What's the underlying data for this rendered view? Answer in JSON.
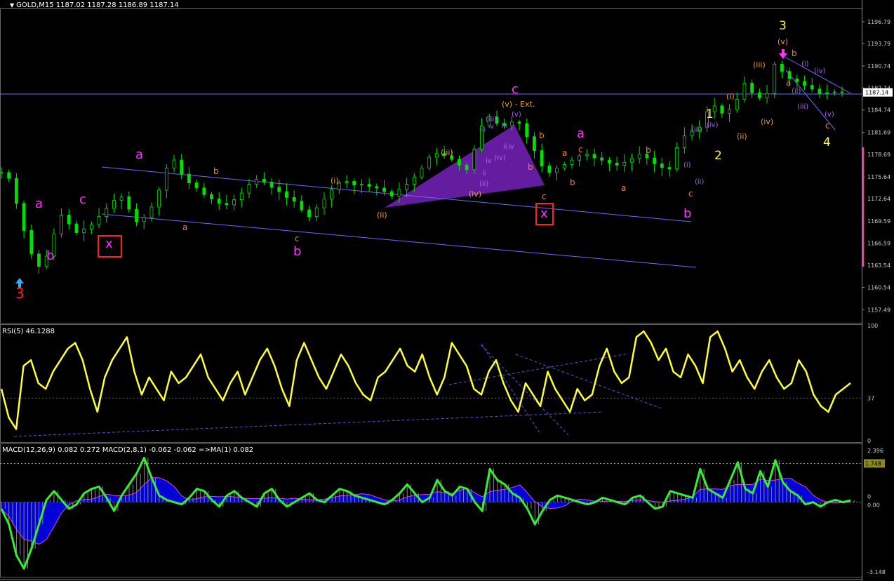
{
  "window": {
    "symbol_header": "GOLD,M15  1187.02 1187.28 1186.89 1187.14",
    "rsi_header": "RSI(5) 46.1288",
    "macd_header": "MACD(12,26,9) 0.082 0.272  MACD(2,8,1) -0.062 -0.062  =>MA(1) 0.082"
  },
  "colors": {
    "background": "#000000",
    "candle": "#00e000",
    "grid": "#3a3ad0",
    "rsi_line": "#ffff33",
    "macd_line": "#33ee33",
    "histogram_pos": "#0000ee",
    "signal_line": "#dd44dd",
    "triangle": "#6a1fa8",
    "magenta": "#ff33ff",
    "orange": "#ff7a33",
    "gold": "#f0a030",
    "yellow": "#ffee44",
    "violet": "#b060ff",
    "red": "#ff2020"
  },
  "chart_data": [
    {
      "type": "line",
      "panel": "price",
      "symbol": "GOLD,M15",
      "ylim": [
        1155.7,
        1198.6
      ],
      "y_ticks": [
        "1196.79",
        "1193.79",
        "1190.74",
        "1187.74",
        "1184.74",
        "1181.69",
        "1178.69",
        "1175.64",
        "1172.64",
        "1169.59",
        "1166.59",
        "1163.54",
        "1160.54",
        "1157.49"
      ],
      "current_price": "1187.14",
      "current_price_value": 1187.14,
      "close_series": [
        1176.2,
        1175.4,
        1172.0,
        1168.3,
        1165.1,
        1163.4,
        1164.8,
        1167.8,
        1170.4,
        1169.2,
        1168.0,
        1168.5,
        1169.1,
        1170.2,
        1171.3,
        1172.4,
        1172.9,
        1171.2,
        1169.5,
        1170.1,
        1171.5,
        1173.8,
        1176.8,
        1177.9,
        1176.0,
        1174.8,
        1174.1,
        1173.2,
        1172.6,
        1172.0,
        1171.8,
        1172.5,
        1173.4,
        1174.6,
        1175.3,
        1174.9,
        1174.2,
        1173.6,
        1172.8,
        1172.3,
        1171.1,
        1170.2,
        1171.4,
        1172.6,
        1173.9,
        1174.8,
        1175.0,
        1174.5,
        1174.6,
        1174.3,
        1174.1,
        1173.6,
        1173.0,
        1173.9,
        1174.6,
        1175.6,
        1176.8,
        1178.3,
        1178.8,
        1178.5,
        1178.0,
        1177.2,
        1176.6,
        1179.4,
        1182.6,
        1183.8,
        1182.9,
        1182.6,
        1183.1,
        1182.9,
        1181.1,
        1179.2,
        1177.1,
        1176.2,
        1176.8,
        1177.3,
        1177.9,
        1178.5,
        1178.7,
        1178.2,
        1177.9,
        1177.5,
        1177.2,
        1177.6,
        1178.1,
        1178.7,
        1178.2,
        1177.4,
        1176.9,
        1176.7,
        1179.6,
        1181.2,
        1181.9,
        1182.4,
        1184.5,
        1185.3,
        1184.3,
        1184.8,
        1186.2,
        1188.4,
        1187.1,
        1186.4,
        1187.0,
        1191.0,
        1190.0,
        1189.0,
        1188.6,
        1188.1,
        1187.6,
        1187.0,
        1187.1,
        1187.2,
        1187.1
      ],
      "channel_lines": [
        {
          "from": [
            145,
            238
          ],
          "to": [
            985,
            316
          ]
        },
        {
          "from": [
            145,
            305
          ],
          "to": [
            992,
            381
          ]
        },
        {
          "from": [
            0,
            134
          ],
          "to": [
            1228,
            134
          ]
        },
        {
          "from": [
            1120,
            82
          ],
          "to": [
            1212,
            133
          ]
        },
        {
          "from": [
            1120,
            100
          ],
          "to": [
            1190,
            185
          ]
        }
      ],
      "triangle": [
        [
          548,
          296
        ],
        [
          733,
          178
        ],
        [
          776,
          264
        ]
      ],
      "annotations": [
        {
          "text": "3",
          "color": "red",
          "pos": [
            22,
            425
          ],
          "size": 20
        },
        {
          "text": "a",
          "color": "magenta",
          "pos": [
            50,
            296
          ],
          "size": 18
        },
        {
          "text": "b",
          "color": "magenta",
          "pos": [
            66,
            370
          ],
          "size": 18
        },
        {
          "text": "c",
          "color": "magenta",
          "pos": [
            113,
            290
          ],
          "size": 18
        },
        {
          "text": "a",
          "color": "magenta",
          "pos": [
            193,
            226
          ],
          "size": 18
        },
        {
          "text": "b",
          "color": "magenta",
          "pos": [
            418,
            364
          ],
          "size": 18
        },
        {
          "text": "c",
          "color": "magenta",
          "pos": [
            729,
            133
          ],
          "size": 18
        },
        {
          "text": "a",
          "color": "magenta",
          "pos": [
            822,
            196
          ],
          "size": 18
        },
        {
          "text": "b",
          "color": "magenta",
          "pos": [
            974,
            310
          ],
          "size": 18
        },
        {
          "text": "x",
          "color": "magenta",
          "pos": [
            150,
            353
          ],
          "size": 18
        },
        {
          "text": "x",
          "color": "magenta",
          "pos": [
            770,
            310
          ],
          "size": 18
        },
        {
          "text": "1",
          "color": "yellow",
          "pos": [
            1006,
            168
          ],
          "size": 17
        },
        {
          "text": "2",
          "color": "yellow",
          "pos": [
            1018,
            227
          ],
          "size": 17
        },
        {
          "text": "3",
          "color": "yellow",
          "pos": [
            1110,
            42
          ],
          "size": 17
        },
        {
          "text": "4",
          "color": "yellow",
          "pos": [
            1173,
            208
          ],
          "size": 17
        },
        {
          "text": "(v) - Ext.",
          "color": "gold",
          "pos": [
            715,
            152
          ],
          "size": 11
        },
        {
          "text": "b",
          "color": "orange",
          "pos": [
            304,
            248
          ],
          "size": 12
        },
        {
          "text": "a",
          "color": "orange",
          "pos": [
            260,
            328
          ],
          "size": 12
        },
        {
          "text": "c",
          "color": "orange",
          "pos": [
            420,
            344
          ],
          "size": 12
        },
        {
          "text": "(i)",
          "color": "gold",
          "pos": [
            471,
            261
          ],
          "size": 11
        },
        {
          "text": "(ii)",
          "color": "gold",
          "pos": [
            537,
            310
          ],
          "size": 11
        },
        {
          "text": "(iii)",
          "color": "gold",
          "pos": [
            628,
            221
          ],
          "size": 11
        },
        {
          "text": "(iv)",
          "color": "gold",
          "pos": [
            668,
            280
          ],
          "size": 11
        },
        {
          "text": "iii",
          "color": "violet",
          "pos": [
            684,
            188
          ],
          "size": 10
        },
        {
          "text": "(iii)",
          "color": "violet",
          "pos": [
            692,
            173
          ],
          "size": 10
        },
        {
          "text": "v",
          "color": "violet",
          "pos": [
            698,
            183
          ],
          "size": 10
        },
        {
          "text": "iii",
          "color": "violet",
          "pos": [
            715,
            182
          ],
          "size": 10
        },
        {
          "text": "(v)",
          "color": "violet",
          "pos": [
            729,
            166
          ],
          "size": 10
        },
        {
          "text": "iv",
          "color": "violet",
          "pos": [
            692,
            232
          ],
          "size": 10
        },
        {
          "text": "(iv)",
          "color": "violet",
          "pos": [
            704,
            228
          ],
          "size": 10
        },
        {
          "text": "ii",
          "color": "violet",
          "pos": [
            717,
            212
          ],
          "size": 10
        },
        {
          "text": "iv",
          "color": "violet",
          "pos": [
            724,
            212
          ],
          "size": 10
        },
        {
          "text": "ii",
          "color": "violet",
          "pos": [
            687,
            250
          ],
          "size": 10
        },
        {
          "text": "(ii)",
          "color": "violet",
          "pos": [
            683,
            265
          ],
          "size": 10
        },
        {
          "text": "b",
          "color": "orange",
          "pos": [
            768,
            197
          ],
          "size": 12
        },
        {
          "text": "b",
          "color": "orange",
          "pos": [
            752,
            242
          ],
          "size": 12
        },
        {
          "text": "c",
          "color": "orange",
          "pos": [
            772,
            284
          ],
          "size": 12
        },
        {
          "text": "a",
          "color": "orange",
          "pos": [
            801,
            222
          ],
          "size": 12
        },
        {
          "text": "c",
          "color": "orange",
          "pos": [
            824,
            217
          ],
          "size": 12
        },
        {
          "text": "b",
          "color": "orange",
          "pos": [
            812,
            264
          ],
          "size": 12
        },
        {
          "text": "a",
          "color": "orange",
          "pos": [
            885,
            272
          ],
          "size": 12
        },
        {
          "text": "b",
          "color": "orange",
          "pos": [
            920,
            218
          ],
          "size": 12
        },
        {
          "text": "c",
          "color": "orange",
          "pos": [
            981,
            280
          ],
          "size": 12
        },
        {
          "text": "(i)",
          "color": "violet",
          "pos": [
            974,
            238
          ],
          "size": 10
        },
        {
          "text": "(ii)",
          "color": "violet",
          "pos": [
            990,
            262
          ],
          "size": 10
        },
        {
          "text": "(iii)",
          "color": "violet",
          "pos": [
            985,
            188
          ],
          "size": 10
        },
        {
          "text": "(iv)",
          "color": "violet",
          "pos": [
            1007,
            181
          ],
          "size": 10
        },
        {
          "text": "(i)",
          "color": "gold",
          "pos": [
            1035,
            141
          ],
          "size": 11
        },
        {
          "text": "(ii)",
          "color": "gold",
          "pos": [
            1050,
            198
          ],
          "size": 11
        },
        {
          "text": "(iii)",
          "color": "gold",
          "pos": [
            1073,
            96
          ],
          "size": 11
        },
        {
          "text": "(iv)",
          "color": "gold",
          "pos": [
            1084,
            177
          ],
          "size": 11
        },
        {
          "text": "(v)",
          "color": "gold",
          "pos": [
            1108,
            63
          ],
          "size": 11
        },
        {
          "text": "b",
          "color": "orange",
          "pos": [
            1128,
            80
          ],
          "size": 12
        },
        {
          "text": "a",
          "color": "orange",
          "pos": [
            1120,
            122
          ],
          "size": 12
        },
        {
          "text": "(i)",
          "color": "violet",
          "pos": [
            1142,
            94
          ],
          "size": 10
        },
        {
          "text": "(ii)",
          "color": "violet",
          "pos": [
            1128,
            133
          ],
          "size": 10
        },
        {
          "text": "(iii)",
          "color": "violet",
          "pos": [
            1136,
            155
          ],
          "size": 10
        },
        {
          "text": "(iv)",
          "color": "violet",
          "pos": [
            1160,
            104
          ],
          "size": 10
        },
        {
          "text": "(v)",
          "color": "violet",
          "pos": [
            1175,
            166
          ],
          "size": 10
        },
        {
          "text": "c",
          "color": "orange",
          "pos": [
            1176,
            183
          ],
          "size": 12
        }
      ]
    },
    {
      "type": "line",
      "panel": "rsi",
      "name": "RSI(5)",
      "ylim": [
        0,
        100
      ],
      "y_ticks": [
        "100",
        "37",
        "0"
      ],
      "level": 37,
      "values": [
        45,
        20,
        10,
        65,
        70,
        50,
        45,
        60,
        70,
        80,
        85,
        70,
        45,
        25,
        55,
        70,
        80,
        90,
        60,
        40,
        55,
        45,
        35,
        60,
        50,
        55,
        65,
        75,
        55,
        45,
        35,
        50,
        60,
        40,
        55,
        70,
        80,
        65,
        45,
        30,
        70,
        85,
        70,
        55,
        45,
        60,
        75,
        65,
        50,
        40,
        35,
        55,
        60,
        70,
        80,
        65,
        60,
        75,
        55,
        40,
        55,
        85,
        75,
        65,
        45,
        40,
        60,
        70,
        50,
        35,
        25,
        50,
        40,
        30,
        60,
        45,
        35,
        25,
        45,
        35,
        40,
        65,
        80,
        60,
        50,
        55,
        90,
        95,
        85,
        70,
        80,
        60,
        55,
        75,
        65,
        50,
        90,
        95,
        80,
        60,
        70,
        55,
        45,
        60,
        70,
        55,
        45,
        50,
        70,
        60,
        40,
        30,
        25,
        40,
        45,
        50
      ]
    },
    {
      "type": "line",
      "panel": "macd",
      "name": "MACD",
      "ylim": [
        -3.148,
        2.396
      ],
      "y_ticks": [
        "2.396",
        "1.748",
        "0",
        "0.00",
        "-3.148"
      ],
      "values": [
        -0.3,
        -1.0,
        -2.4,
        -3.0,
        -2.1,
        -1.0,
        0.1,
        0.5,
        0.1,
        -0.3,
        -0.1,
        0.4,
        0.6,
        0.7,
        0.2,
        -0.4,
        0.3,
        0.8,
        1.3,
        2.0,
        1.1,
        0.3,
        0.1,
        0.0,
        -0.1,
        0.2,
        0.6,
        0.5,
        0.1,
        -0.2,
        0.3,
        0.5,
        0.2,
        0.0,
        -0.2,
        0.4,
        0.6,
        0.1,
        -0.2,
        0.0,
        0.2,
        0.4,
        0.1,
        0.0,
        0.3,
        0.6,
        0.5,
        0.3,
        0.2,
        0.1,
        0.0,
        -0.1,
        0.1,
        0.4,
        0.8,
        0.4,
        0.0,
        0.2,
        1.0,
        0.5,
        0.3,
        0.7,
        0.6,
        0.0,
        -0.4,
        1.5,
        1.0,
        0.8,
        0.4,
        0.2,
        -0.3,
        -1.0,
        -0.4,
        0.1,
        0.3,
        0.2,
        0.1,
        0.0,
        -0.1,
        0.0,
        0.2,
        0.1,
        0.0,
        -0.1,
        0.2,
        0.3,
        0.0,
        -0.3,
        -0.2,
        0.5,
        0.4,
        0.3,
        0.2,
        1.5,
        0.6,
        0.4,
        0.2,
        1.0,
        1.8,
        0.6,
        0.4,
        1.4,
        0.7,
        1.9,
        0.9,
        0.5,
        0.3,
        -0.1,
        0.0,
        -0.2,
        0.0,
        0.1,
        0.0,
        0.08
      ]
    }
  ]
}
